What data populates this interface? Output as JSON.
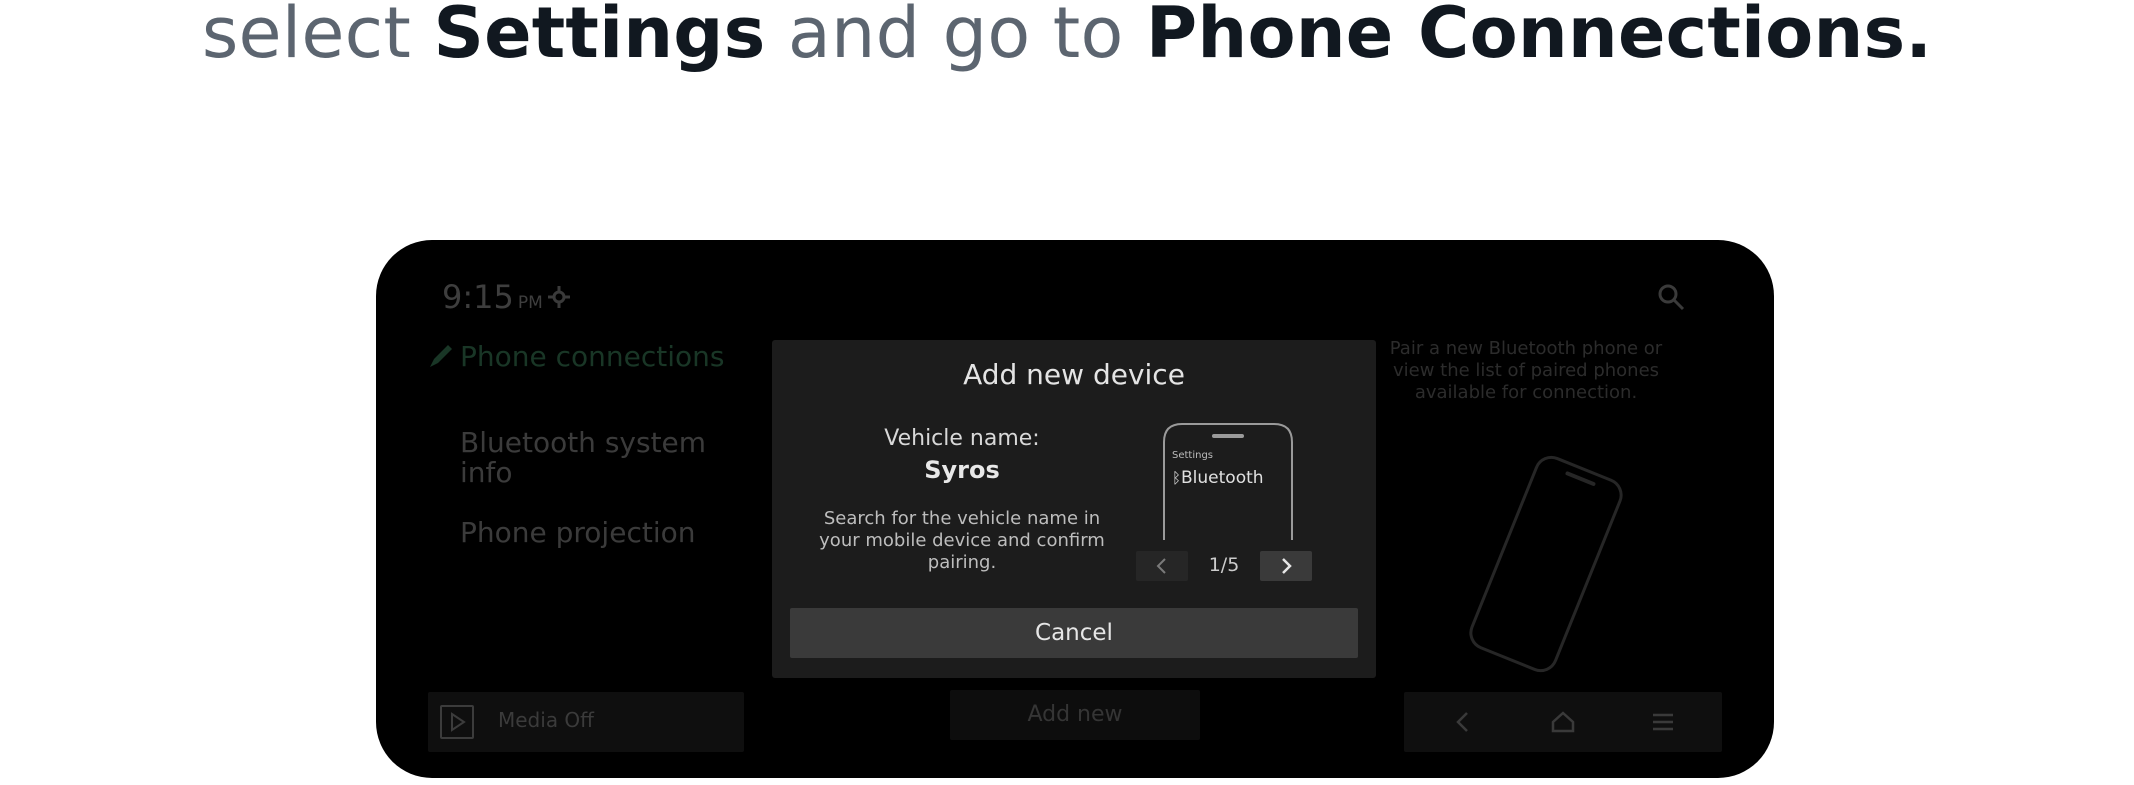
{
  "headline": {
    "part1": "select ",
    "part2": "Settings",
    "part3": " and go to ",
    "part4": "Phone Connections."
  },
  "status_bar": {
    "time": "9:15",
    "ampm": "PM",
    "status_icon": "antenna-sync-icon"
  },
  "sidebar": {
    "items": [
      {
        "label": "Phone connections",
        "active": true
      },
      {
        "label": "Bluetooth system info",
        "active": false
      },
      {
        "label": "Phone projection",
        "active": false
      }
    ],
    "media_label": "Media Off"
  },
  "center": {
    "add_new_label": "Add new"
  },
  "right_panel": {
    "description": "Pair a new Bluetooth phone or view the list of paired phones available for connection."
  },
  "dialog": {
    "title": "Add new device",
    "vehicle_name_label": "Vehicle name:",
    "vehicle_name_value": "Syros",
    "description": "Search for the vehicle name in your mobile device and confirm pairing.",
    "illustration_settings": "Settings",
    "illustration_bluetooth": "Bluetooth",
    "pager_text": "1/5",
    "cancel_label": "Cancel"
  },
  "icons": {
    "search": "search-icon",
    "back": "back-arrow-icon",
    "home": "home-icon",
    "menu": "menu-icon",
    "play": "play-icon",
    "pencil": "pencil-icon"
  },
  "colors": {
    "headline_gray": "#5c6570",
    "headline_dark": "#111820",
    "screen_bg": "#000000",
    "dialog_bg": "#1c1c1c",
    "button_bg": "#3a3a3a"
  }
}
